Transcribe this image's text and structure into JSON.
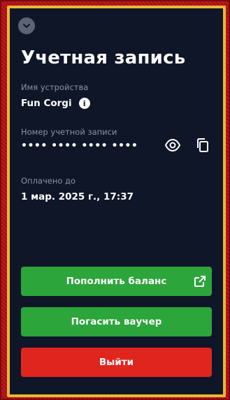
{
  "account": {
    "title": "Учетная запись",
    "device_label": "Имя устройства",
    "device_name": "Fun Corgi",
    "account_number_label": "Номер учетной записи",
    "account_number_masked": "•••• •••• •••• ••••",
    "paid_until_label": "Оплачено до",
    "paid_until_value": "1 мар. 2025 г., 17:37"
  },
  "actions": {
    "top_up_label": "Пополнить баланс",
    "redeem_voucher_label": "Погасить ваучер",
    "logout_label": "Выйти"
  },
  "colors": {
    "panel_bg": "#0e1628",
    "primary_green": "#2ca53a",
    "danger_red": "#e0251f",
    "muted_text": "#8d93a1"
  },
  "icons": [
    "chevron-down-icon",
    "info-icon",
    "eye-icon",
    "copy-icon",
    "external-link-icon"
  ]
}
